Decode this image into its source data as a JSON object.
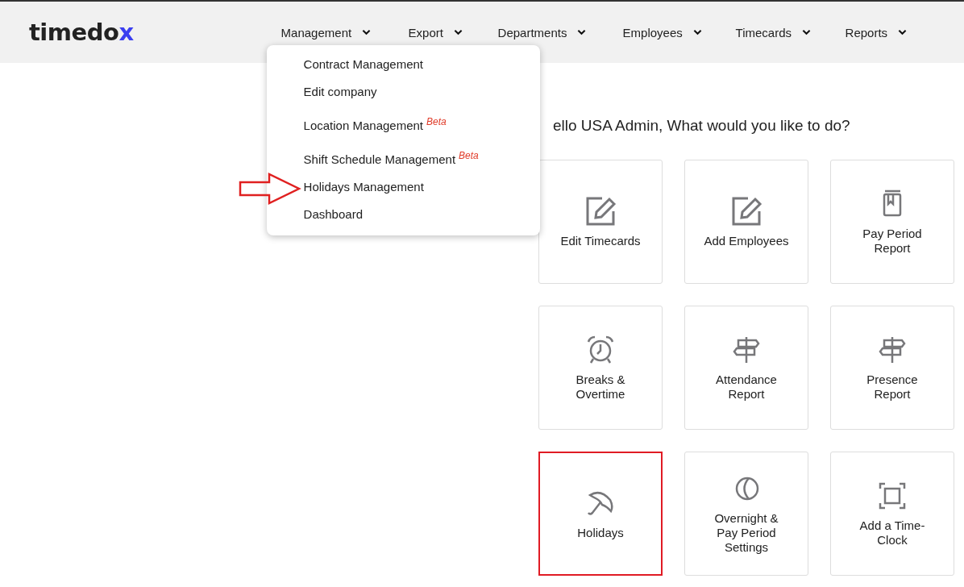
{
  "logo": {
    "text": "timedo",
    "accent": "x"
  },
  "nav": [
    {
      "label": "Management",
      "expanded": true
    },
    {
      "label": "Export",
      "expanded": false
    },
    {
      "label": "Departments",
      "expanded": false
    },
    {
      "label": "Employees",
      "expanded": false
    },
    {
      "label": "Timecards",
      "expanded": false
    },
    {
      "label": "Reports",
      "expanded": false
    }
  ],
  "dropdown": [
    {
      "label": "Contract Management",
      "highlighted": false
    },
    {
      "label": "Edit company",
      "highlighted": false
    },
    {
      "label": "Location Management",
      "badge": "Beta",
      "highlighted": false
    },
    {
      "label": "Shift Schedule Management",
      "badge": "Beta",
      "highlighted": false
    },
    {
      "label": "Holidays Management",
      "highlighted": true
    },
    {
      "label": "Dashboard",
      "highlighted": false
    }
  ],
  "greeting": "ello USA Admin, What would you like to do?",
  "tiles": [
    {
      "label": "Edit Timecards",
      "kind": "edit",
      "highlighted": false
    },
    {
      "label": "Add Employees",
      "kind": "edit",
      "highlighted": false
    },
    {
      "label": "Pay Period Report",
      "kind": "book",
      "highlighted": false
    },
    {
      "label": "Breaks & Overtime",
      "kind": "alarm",
      "highlighted": false
    },
    {
      "label": "Attendance Report",
      "kind": "signpost",
      "highlighted": false
    },
    {
      "label": "Presence Report",
      "kind": "signpost",
      "highlighted": false
    },
    {
      "label": "Holidays",
      "kind": "umbrella",
      "highlighted": true
    },
    {
      "label": "Overnight & Pay Period Settings",
      "kind": "moon",
      "highlighted": false
    },
    {
      "label": "Add a Time-Clock",
      "kind": "frame",
      "highlighted": false
    }
  ]
}
